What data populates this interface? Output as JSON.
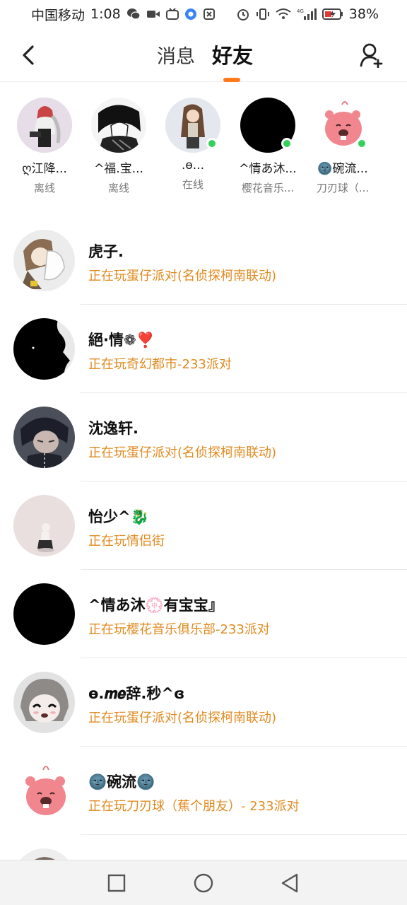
{
  "status_bar": {
    "carrier": "中国移动",
    "time": "1:08",
    "network": "4G",
    "battery": "38%"
  },
  "header": {
    "back_icon": "chevron-left-icon",
    "tabs": [
      {
        "label": "消息",
        "active": false
      },
      {
        "label": "好友",
        "active": true
      }
    ],
    "add_friend_icon": "add-user-icon",
    "accent_color": "#ff7a1a"
  },
  "online_friends": [
    {
      "name": "ღ江降...",
      "status": "离线",
      "online": false
    },
    {
      "name": "^福.宝...",
      "status": "离线",
      "online": false
    },
    {
      "name": ".ɵ...",
      "status": "在线",
      "online": true
    },
    {
      "name": "^情あ沐...",
      "status": "樱花音乐...",
      "online": true
    },
    {
      "name": "🌚碗流...",
      "status": "刀刃球（...",
      "online": true
    }
  ],
  "friends": [
    {
      "name": "虎子.",
      "activity": "正在玩蛋仔派对(名侦探柯南联动)"
    },
    {
      "name": "絕·情❁❣️",
      "activity": "正在玩奇幻都市-233派对"
    },
    {
      "name": "沈逸轩.",
      "activity": "正在玩蛋仔派对(名侦探柯南联动)"
    },
    {
      "name": "怡少^🐉",
      "activity": "正在玩情侣街"
    },
    {
      "name": "^情あ沐💮有宝宝』",
      "activity": "正在玩樱花音乐俱乐部-233派对"
    },
    {
      "name": "ɵ.𝒎𝒆辞.秒^ɞ",
      "activity": "正在玩蛋仔派对(名侦探柯南联动)"
    },
    {
      "name": "🌚碗流🌚",
      "activity": "正在玩刀刃球（蕉个朋友）- 233派对"
    }
  ],
  "activity_color": "#e08a1f",
  "nav_bar": {
    "recent_icon": "square-icon",
    "home_icon": "circle-icon",
    "back_icon": "triangle-back-icon"
  }
}
